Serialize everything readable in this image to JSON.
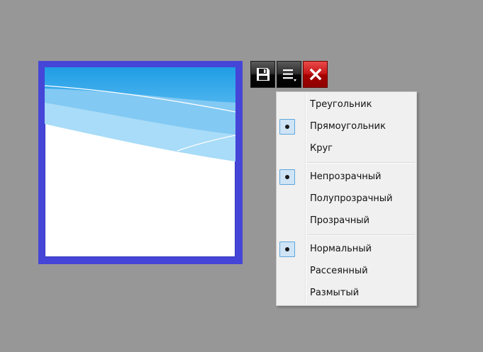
{
  "toolbar": {
    "buttons": [
      {
        "name": "save",
        "icon": "floppy-disk-icon",
        "color": "#000000"
      },
      {
        "name": "menu",
        "icon": "menu-list-icon",
        "color": "#000000"
      },
      {
        "name": "close",
        "icon": "close-x-icon",
        "color": "#c41616"
      }
    ]
  },
  "preview": {
    "frame_color": "#4545d8",
    "sky_colors": [
      "#29a3e6",
      "#7cc6f2",
      "#a9dcf8"
    ]
  },
  "menu": {
    "groups": [
      {
        "items": [
          {
            "label": "Треугольник",
            "checked": false
          },
          {
            "label": "Прямоугольник",
            "checked": true
          },
          {
            "label": "Круг",
            "checked": false
          }
        ]
      },
      {
        "items": [
          {
            "label": "Непрозрачный",
            "checked": true
          },
          {
            "label": "Полупрозрачный",
            "checked": false
          },
          {
            "label": "Прозрачный",
            "checked": false
          }
        ]
      },
      {
        "items": [
          {
            "label": "Нормальный",
            "checked": true
          },
          {
            "label": "Рассеянный",
            "checked": false
          },
          {
            "label": "Размытый",
            "checked": false
          }
        ]
      }
    ]
  }
}
